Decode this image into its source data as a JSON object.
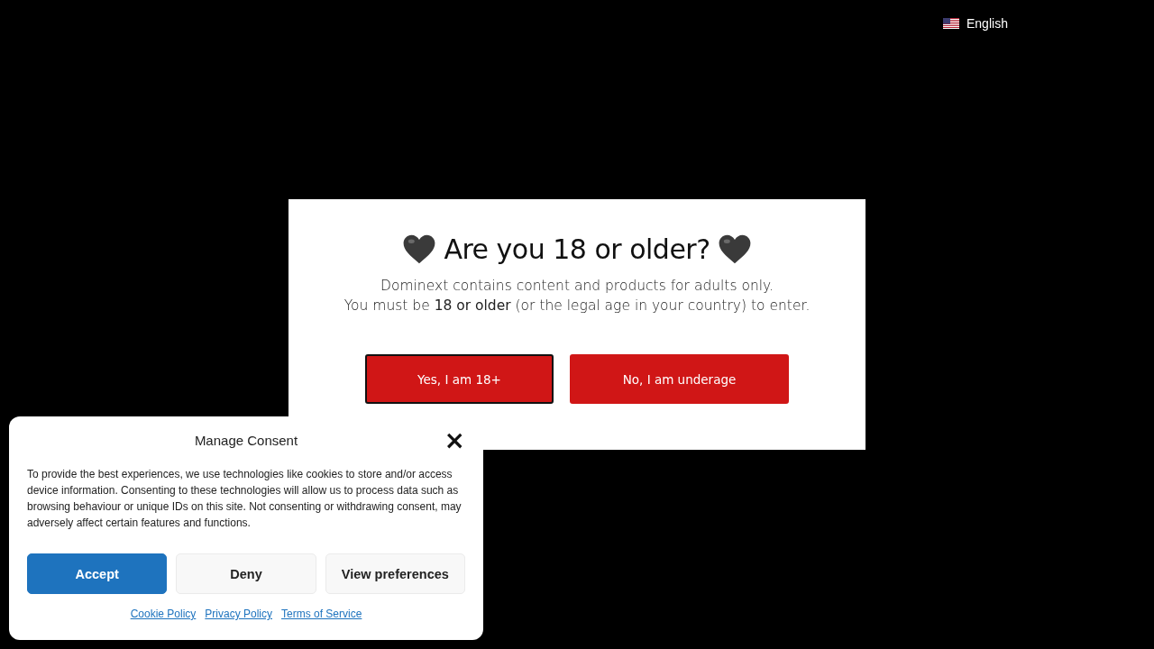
{
  "language_switcher": {
    "label": "English"
  },
  "age_gate": {
    "title": "Are you 18 or older?",
    "message_lines": [
      "Dominext contains content and products for adults only.",
      "You must be **18 or older** (or the legal age in your country) to enter."
    ],
    "buttons": [
      {
        "label": "Yes, I am 18+",
        "focused": true
      },
      {
        "label": "No, I am underage",
        "focused": false
      }
    ]
  },
  "consent": {
    "title": "Manage Consent",
    "close": "×",
    "text": "To provide the best experiences, we use technologies like cookies to store and/or access device information. Consenting to these technologies will allow us to process data such as browsing behaviour or unique IDs on this site. Not consenting or withdrawing consent, may adversely affect certain features and functions.",
    "buttons": [
      {
        "label": "Accept",
        "kind": "primary"
      },
      {
        "label": "Deny",
        "kind": "secondary"
      },
      {
        "label": "View preferences",
        "kind": "secondary"
      }
    ],
    "links": [
      "Cookie Policy",
      "Privacy Policy",
      "Terms of Service"
    ]
  }
}
